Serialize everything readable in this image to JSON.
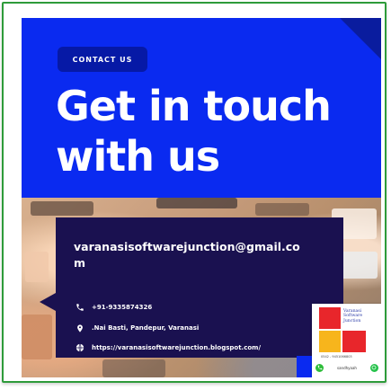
{
  "contact_label": "CONTACT US",
  "headline": "Get in touch with us",
  "email": "varanasisoftwarejunction@gmail.com",
  "phone": "+91-9335874326",
  "address": ".Nai Basti, Pandepur, Varanasi",
  "website": "https://varanasisoftwarejunction.blogspot.com/",
  "logo": {
    "text": "Varanasi Software Junction",
    "phone": "0542 - 9451066803",
    "handle": "sandhyaah"
  },
  "icons": {
    "phone": "phone-icon",
    "location": "location-pin-icon",
    "globe": "globe-icon",
    "whatsapp": "whatsapp-icon"
  },
  "colors": {
    "brand_blue": "#0a2af0",
    "navy_box": "#1a1150",
    "pill": "#0619a6",
    "logo_red": "#e8262b",
    "logo_yellow": "#f7b51c",
    "border_green": "#2e9b3a"
  }
}
